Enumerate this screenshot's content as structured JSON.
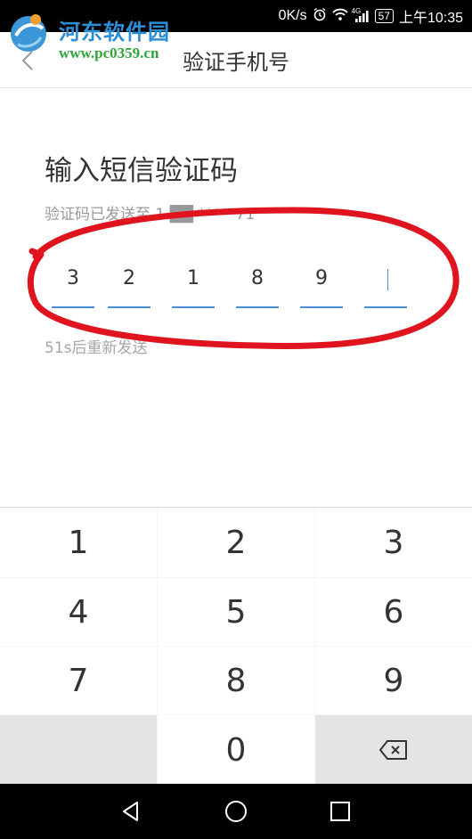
{
  "status_bar": {
    "net_speed": "0K/s",
    "network_type": "4G",
    "battery": "57",
    "time": "上午10:35",
    "icons": [
      "alarm-icon",
      "wifi-icon",
      "signal-icon",
      "battery-icon"
    ]
  },
  "watermark": {
    "title": "河东软件园",
    "url": "www.pc0359.cn"
  },
  "header": {
    "title": "验证手机号"
  },
  "main": {
    "heading": "输入短信验证码",
    "sent_to": "验证码已发送至 1 ██ *****71",
    "code_digits": [
      "3",
      "2",
      "1",
      "8",
      "9",
      ""
    ],
    "resend": "51s后重新发送"
  },
  "keypad": {
    "keys": [
      "1",
      "2",
      "3",
      "4",
      "5",
      "6",
      "7",
      "8",
      "9",
      "",
      "0",
      "⌫"
    ]
  },
  "colors": {
    "accent": "#4a8ad6",
    "annotation": "#e0141e",
    "statusbar": "#000000"
  }
}
